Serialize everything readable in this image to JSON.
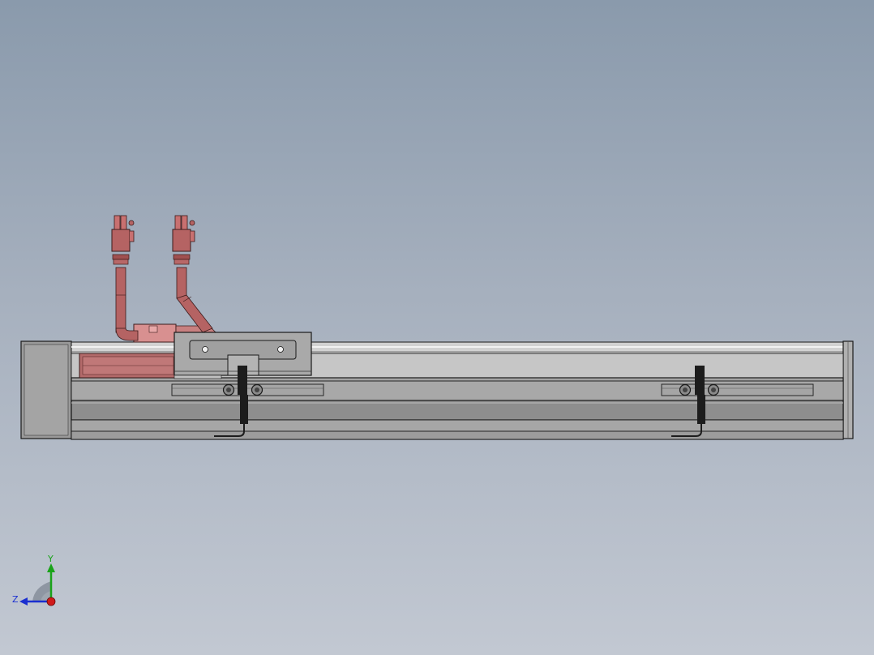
{
  "viewport": {
    "background_top": "#8a9aac",
    "background_bottom": "#c2c8d2"
  },
  "model": {
    "rail_color": "#a8a8a8",
    "rail_dark": "#8c8c8c",
    "edge_color": "#1a1a1a",
    "motor_color": "#b36a6a",
    "sensor_color": "#1c1c1c"
  },
  "triad": {
    "y_label": "Y",
    "z_label": "Z",
    "y_color": "#1aa31a",
    "z_color": "#1a2fd0",
    "x_color": "#d01a1a"
  }
}
